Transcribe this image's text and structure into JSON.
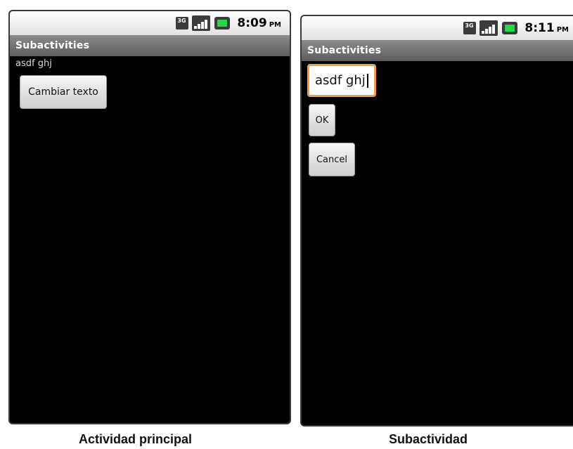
{
  "left": {
    "status": {
      "time": "8:09",
      "ampm": "PM"
    },
    "title": "Subactivities",
    "text_label": "asdf ghj",
    "button_label": "Cambiar texto",
    "caption": "Actividad principal"
  },
  "right": {
    "status": {
      "time": "8:11",
      "ampm": "PM"
    },
    "title": "Subactivities",
    "edit_value": "asdf ghj",
    "ok_label": "OK",
    "cancel_label": "Cancel",
    "caption": "Subactividad"
  },
  "icons": [
    "3g-icon",
    "signal-icon",
    "battery-icon"
  ],
  "colors": {
    "screen": "#000000",
    "titlebar": "#707070",
    "focus_border": "#f0a046",
    "battery": "#28d64a"
  }
}
